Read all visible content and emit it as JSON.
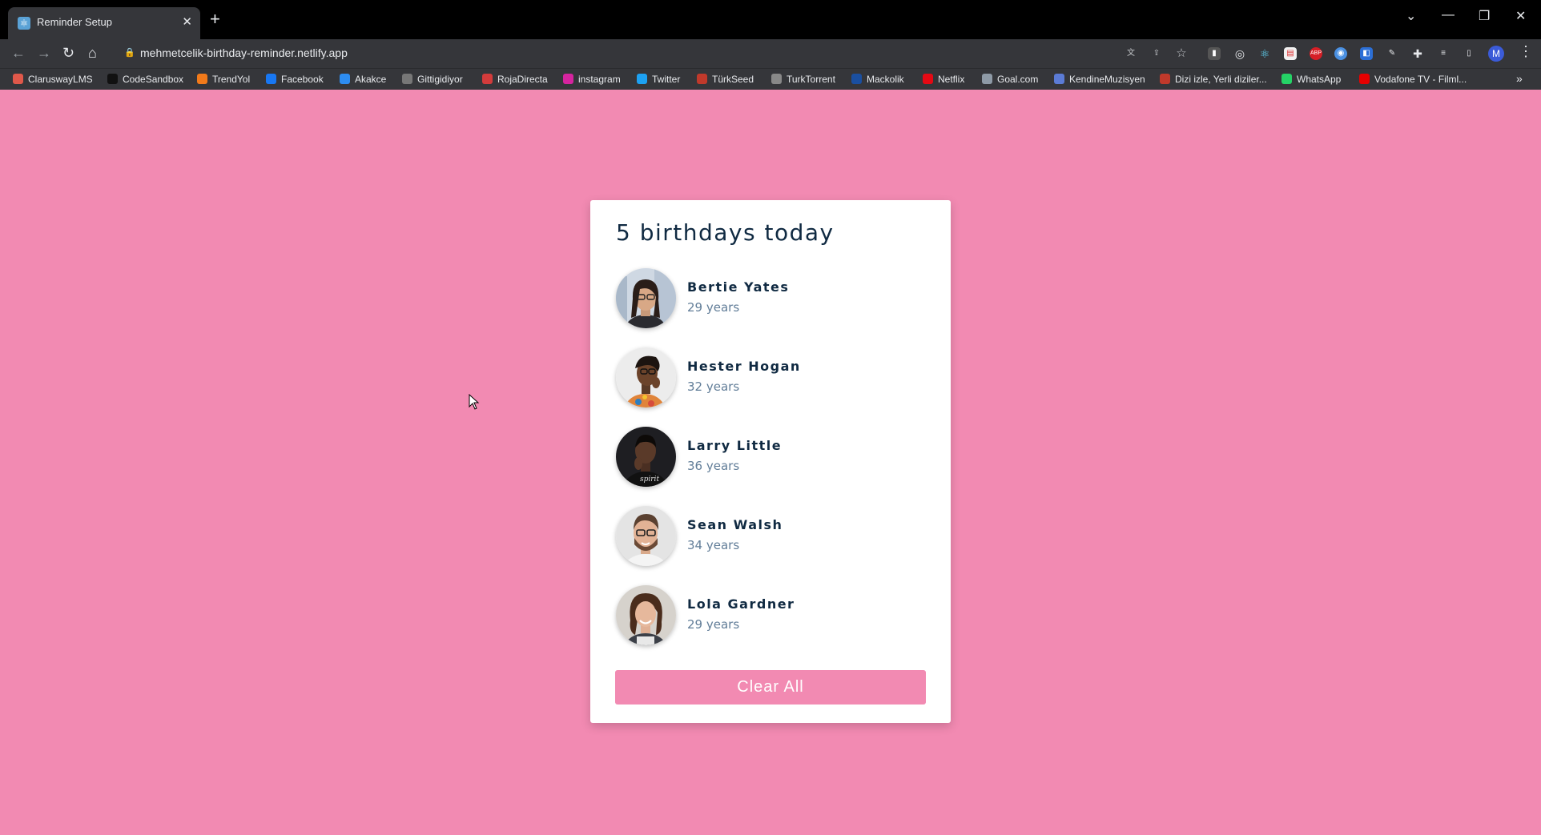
{
  "browser": {
    "tab_title": "Reminder Setup",
    "url": "mehmetcelik-birthday-reminder.netlify.app",
    "profile_initial": "M",
    "bookmarks": [
      {
        "label": "ClaruswayLMS",
        "color": "#e0584a"
      },
      {
        "label": "CodeSandbox",
        "color": "#111111"
      },
      {
        "label": "TrendYol",
        "color": "#f27a1a"
      },
      {
        "label": "Facebook",
        "color": "#1877f2"
      },
      {
        "label": "Akakce",
        "color": "#2d8cf0"
      },
      {
        "label": "Gittigidiyor",
        "color": "#777777"
      },
      {
        "label": "RojaDirecta",
        "color": "#d33b3b"
      },
      {
        "label": "instagram",
        "color": "#d6249f"
      },
      {
        "label": "Twitter",
        "color": "#1da1f2"
      },
      {
        "label": "TürkSeed",
        "color": "#c0392b"
      },
      {
        "label": "TurkTorrent",
        "color": "#888888"
      },
      {
        "label": "Mackolik",
        "color": "#1a4fa0"
      },
      {
        "label": "Netflix",
        "color": "#e50914"
      },
      {
        "label": "Goal.com",
        "color": "#8e9aa6"
      },
      {
        "label": "KendineMuzisyen",
        "color": "#5b7bd5"
      },
      {
        "label": "Dizi izle, Yerli diziler...",
        "color": "#c0392b"
      },
      {
        "label": "WhatsApp",
        "color": "#25d366"
      },
      {
        "label": "Vodafone TV - Filml...",
        "color": "#e60000"
      }
    ]
  },
  "app": {
    "title": "5 birthdays today",
    "people": [
      {
        "name": "Bertie Yates",
        "age": "29 years"
      },
      {
        "name": "Hester Hogan",
        "age": "32 years"
      },
      {
        "name": "Larry Little",
        "age": "36 years"
      },
      {
        "name": "Sean Walsh",
        "age": "34 years"
      },
      {
        "name": "Lola Gardner",
        "age": "29 years"
      }
    ],
    "clear_label": "Clear All",
    "accent_color": "#f28ab2"
  }
}
